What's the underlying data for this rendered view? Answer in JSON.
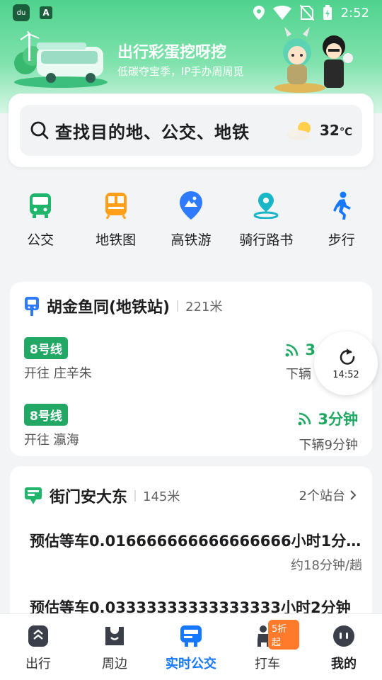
{
  "status_bar": {
    "time": "2:52",
    "app_badge": "du",
    "a_badge": "A"
  },
  "banner": {
    "title": "出行彩蛋挖呀挖",
    "subtitle": "低碳夺宝季，IP手办周周觅"
  },
  "search": {
    "placeholder": "查找目的地、公交、地铁",
    "temperature": "32",
    "temp_unit": "℃"
  },
  "quick_actions": [
    {
      "label": "公交",
      "icon": "bus-icon",
      "color": "#1fb56b"
    },
    {
      "label": "地铁图",
      "icon": "subway-icon",
      "color": "#ff9f1a"
    },
    {
      "label": "高铁游",
      "icon": "location-mountain-icon",
      "color": "#2f7bff"
    },
    {
      "label": "骑行路书",
      "icon": "cycling-route-icon",
      "color": "#18b6c6"
    },
    {
      "label": "步行",
      "icon": "walk-icon",
      "color": "#1677ff"
    }
  ],
  "card1": {
    "stop_name": "胡金鱼同(地铁站)",
    "distance": "221米",
    "routes": [
      {
        "line": "8号线",
        "dest": "开往 庄辛朱",
        "eta": "3",
        "next": "下辆"
      },
      {
        "line": "8号线",
        "dest": "开往 瀛海",
        "eta": "3分钟",
        "next": "下辆9分钟"
      }
    ]
  },
  "refresh": {
    "time": "14:52"
  },
  "card2": {
    "stop_name": "街门安大东",
    "distance": "145米",
    "stations_link": "2个站台",
    "estimate1": "预估等车0.016666666666666666小时1分...",
    "estimate1_sub": "约18分钟/趟",
    "estimate2": "预估等车0.03333333333333333小时2分钟"
  },
  "tabs": [
    {
      "label": "出行",
      "active": false
    },
    {
      "label": "周边",
      "active": false
    },
    {
      "label": "实时公交",
      "active": true
    },
    {
      "label": "打车",
      "active": false,
      "badge": "5折起"
    },
    {
      "label": "我的",
      "active": false
    }
  ],
  "colors": {
    "accent_green": "#1fa862",
    "tab_active": "#1677ff",
    "hero_green": "#4fd28e"
  }
}
